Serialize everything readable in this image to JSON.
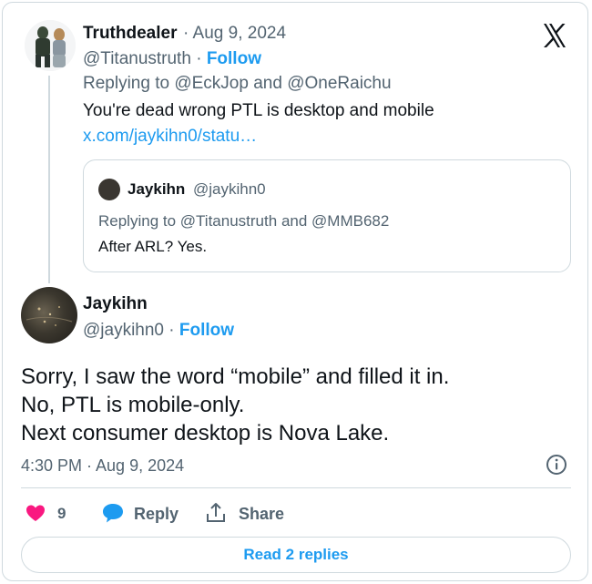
{
  "parent": {
    "name": "Truthdealer",
    "date": "· Aug 9, 2024",
    "handle": "@Titanustruth",
    "follow": "Follow",
    "replying_prefix": "Replying to",
    "replying_to_1": "@EckJop",
    "replying_and": "and",
    "replying_to_2": "@OneRaichu",
    "text": "You're dead wrong PTL is desktop and mobile",
    "link": "x.com/jaykihn0/statu…"
  },
  "quote": {
    "name": "Jaykihn",
    "handle": "@jaykihn0",
    "replying_prefix": "Replying to",
    "replying_to_1": "@Titanustruth",
    "replying_and": "and",
    "replying_to_2": "@MMB682",
    "text": "After ARL? Yes."
  },
  "main": {
    "name": "Jaykihn",
    "handle": "@jaykihn0",
    "follow": "Follow",
    "lines": [
      "Sorry, I saw the word “mobile” and filled it in.",
      "No, PTL is mobile-only.",
      "Next consumer desktop is Nova Lake."
    ],
    "timestamp": "4:30 PM · Aug 9, 2024"
  },
  "actions": {
    "likes": "9",
    "reply": "Reply",
    "share": "Share",
    "read_replies": "Read 2 replies"
  },
  "icons": {
    "logo": "x-logo-icon",
    "info": "info-icon",
    "like": "heart-icon",
    "reply": "speech-bubble-icon",
    "share": "share-icon"
  },
  "colors": {
    "accent": "#1d9bf0",
    "like": "#f91880",
    "muted": "#536471",
    "border": "#cfd9de"
  }
}
